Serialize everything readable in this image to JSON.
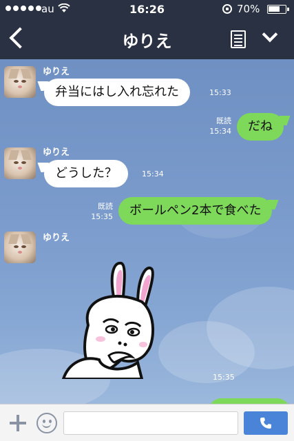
{
  "status_bar": {
    "carrier": "au",
    "time": "16:26",
    "battery_percent": "70%",
    "battery_level": 0.7
  },
  "nav": {
    "title": "ゆりえ",
    "icons": [
      "back-icon",
      "note-icon",
      "chevron-down-icon"
    ]
  },
  "chat": {
    "messages": [
      {
        "side": "left",
        "sender": "ゆりえ",
        "text": "弁当にはし入れ忘れた",
        "time": "15:33"
      },
      {
        "side": "right",
        "read": "既読",
        "text": "だね",
        "time": "15:34"
      },
      {
        "side": "left",
        "sender": "ゆりえ",
        "text": "どうした？",
        "time": "15:34"
      },
      {
        "side": "right",
        "read": "既読",
        "text": "ボールペン2本で食べた",
        "time": "15:35"
      },
      {
        "side": "left",
        "sender": "ゆりえ",
        "sticker": "rabbit-sticker",
        "time": "15:35"
      }
    ]
  },
  "composer": {
    "input_value": "",
    "input_placeholder": "",
    "icons": [
      "plus-icon",
      "emoji-icon",
      "phone-icon"
    ]
  },
  "colors": {
    "header": "#2a3143",
    "chat_background": "#7a9bcc",
    "bubble_right": "#7ed85a",
    "bubble_left": "#ffffff",
    "call_button": "#4a84d8"
  }
}
